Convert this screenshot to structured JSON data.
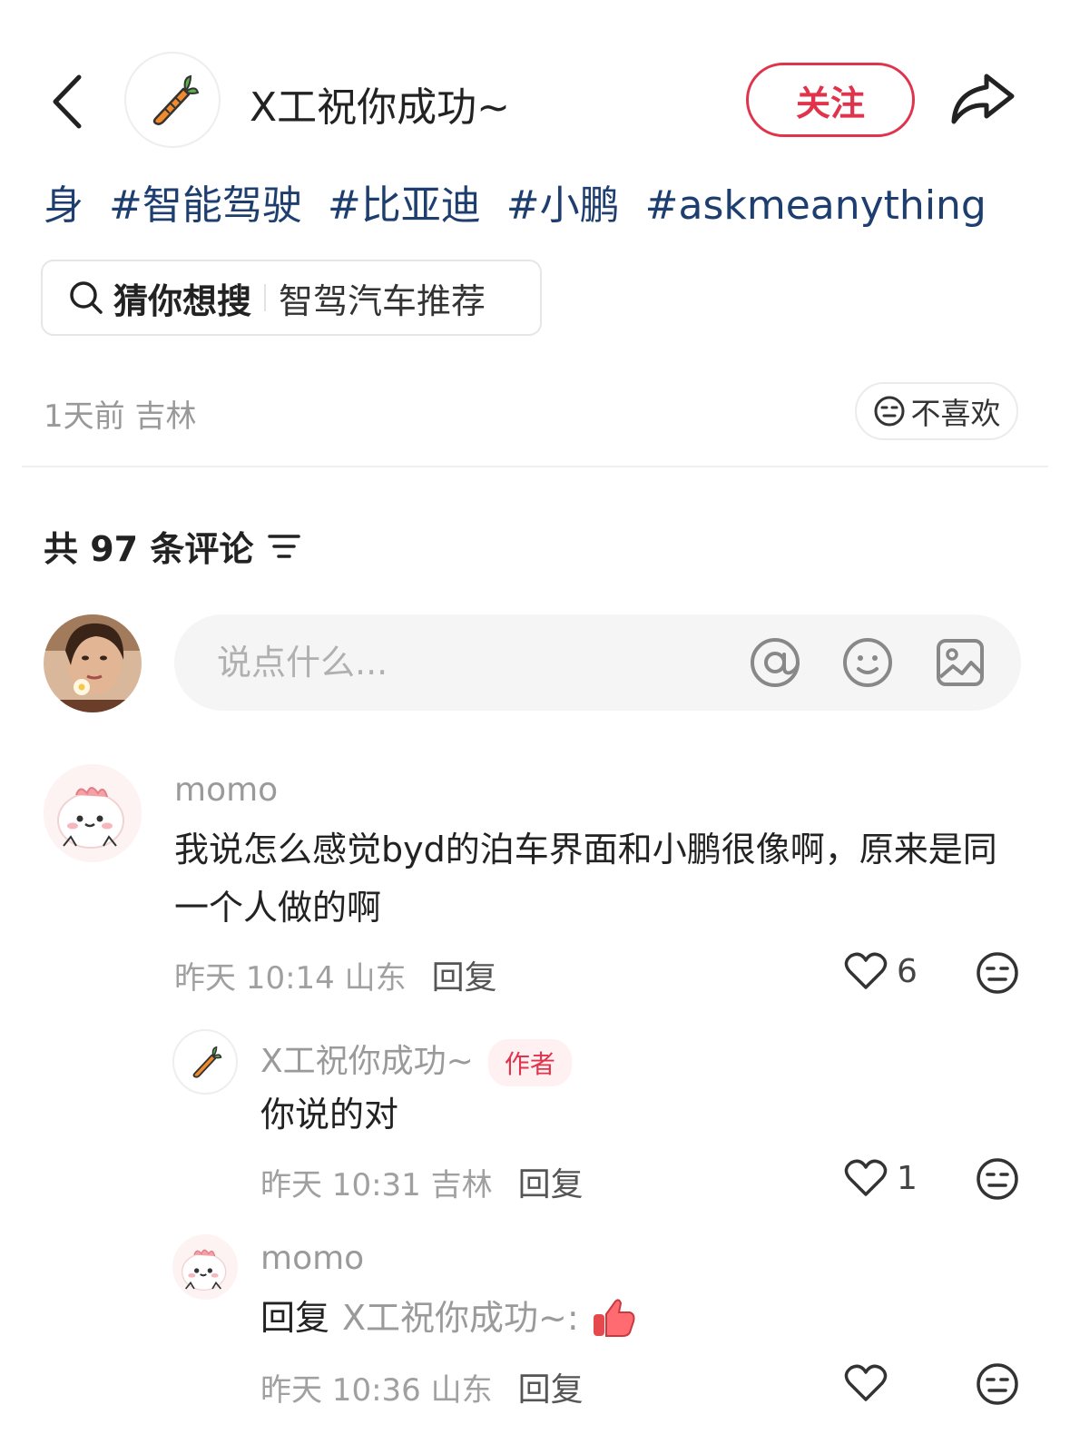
{
  "header": {
    "author_name": "X工祝你成功~",
    "follow_label": "关注"
  },
  "tags": [
    "身",
    "#智能驾驶",
    "#比亚迪",
    "#小鹏",
    "#askmeanything"
  ],
  "search_suggest": {
    "label": "猜你想搜",
    "query": "智驾汽车推荐"
  },
  "post_meta": "1天前 吉林",
  "dislike_label": "不喜欢",
  "comments_header": "共 97 条评论",
  "comment_input": {
    "placeholder": "说点什么..."
  },
  "comments": [
    {
      "user": "momo",
      "text": "我说怎么感觉byd的泊车界面和小鹏很像啊，原来是同一个人做的啊",
      "meta": "昨天 10:14 山东",
      "reply_label": "回复",
      "likes": "6"
    },
    {
      "user": "X工祝你成功~",
      "badge": "作者",
      "text": "你说的对",
      "meta": "昨天 10:31 吉林",
      "reply_label": "回复",
      "likes": "1"
    },
    {
      "user": "momo",
      "reply_prefix": "回复",
      "reply_target": "X工祝你成功~:",
      "meta": "昨天 10:36 山东",
      "reply_label": "回复"
    }
  ],
  "colors": {
    "accent": "#e0344c",
    "tag_blue": "#1d3e6f",
    "muted": "#9a9a9a"
  }
}
